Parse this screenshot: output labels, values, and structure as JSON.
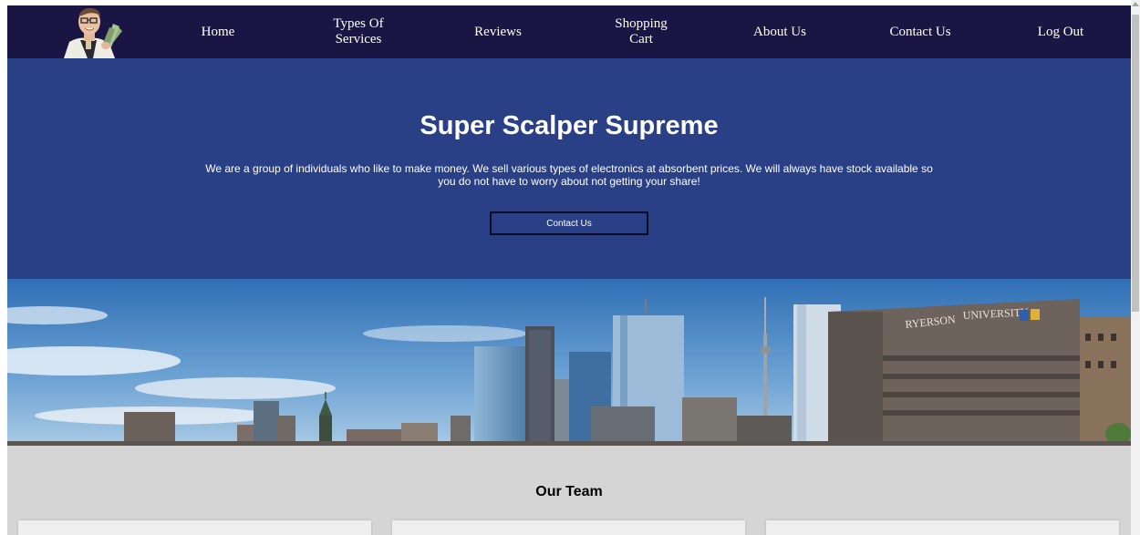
{
  "nav": {
    "items": [
      {
        "label": "Home"
      },
      {
        "label": "Types Of Services"
      },
      {
        "label": "Reviews"
      },
      {
        "label": "Shopping Cart"
      },
      {
        "label": "About Us"
      },
      {
        "label": "Contact Us"
      },
      {
        "label": "Log Out"
      }
    ]
  },
  "hero": {
    "title": "Super Scalper Supreme",
    "description": "We are a group of individuals who like to make money. We sell various types of electronics at absorbent prices. We will always have stock available so you do not have to worry about not getting your share!",
    "button_label": "Contact Us"
  },
  "city": {
    "sign_left": "RYERSON",
    "sign_right": "UNIVERSITY"
  },
  "team": {
    "title": "Our Team"
  },
  "colors": {
    "nav_bg": "#1b1544",
    "hero_bg": "#2a4086",
    "team_bg": "#d5d5d5"
  }
}
